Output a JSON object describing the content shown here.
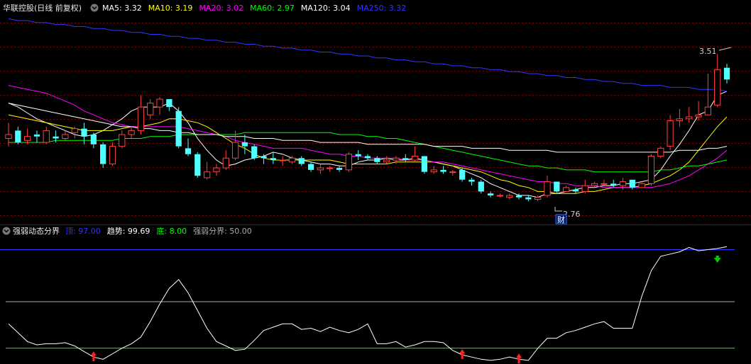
{
  "main_header": {
    "title": "华联控股(日线 前复权)",
    "items": [
      {
        "label": "MA5: 3.32",
        "color": "#ffffff"
      },
      {
        "label": "MA10: 3.19",
        "color": "#ffff00"
      },
      {
        "label": "MA20: 3.02",
        "color": "#ff00ff"
      },
      {
        "label": "MA60: 2.97",
        "color": "#00ff00"
      },
      {
        "label": "MA120: 3.04",
        "color": "#ffffff"
      },
      {
        "label": "MA250: 3.32",
        "color": "#3333ff"
      }
    ]
  },
  "sub_header": {
    "title": "强弱动态分界",
    "items": [
      {
        "label": "顶: 97.00",
        "color": "#3333ff"
      },
      {
        "label": "趋势: 99.69",
        "color": "#ffffff"
      },
      {
        "label": "底: 8.00",
        "color": "#00ff00"
      },
      {
        "label": "强弱分界: 50.00",
        "color": "#aaaaaa"
      }
    ]
  },
  "annotations": {
    "high_label": "3.51",
    "low_label": "2.76",
    "fin_badge": "财"
  },
  "colors": {
    "up": "#ff4040",
    "down": "#50ffff",
    "grid": "#8b0000",
    "ma5": "#ffffff",
    "ma10": "#ffff00",
    "ma20": "#ff00ff",
    "ma60": "#00ff00",
    "ma120": "#ffffff",
    "ma250": "#3333ff",
    "top_line": "#3333ff",
    "mid_line": "#aaaaaa",
    "bottom_line": "#00ff00",
    "buy_arrow": "#ff2020",
    "sell_arrow": "#00cc00"
  },
  "chart_data": [
    {
      "type": "candlestick",
      "title": "华联控股(日线 前复权)",
      "ylim": [
        2.66,
        3.72
      ],
      "candles": [
        [
          3.08,
          3.1,
          3.16,
          3.04
        ],
        [
          3.12,
          3.06,
          3.14,
          3.05
        ],
        [
          3.07,
          3.09,
          3.13,
          3.05
        ],
        [
          3.1,
          3.09,
          3.12,
          3.06
        ],
        [
          3.06,
          3.12,
          3.14,
          3.05
        ],
        [
          3.09,
          3.08,
          3.12,
          3.06
        ],
        [
          3.08,
          3.1,
          3.12,
          3.07
        ],
        [
          3.11,
          3.13,
          3.14,
          3.08
        ],
        [
          3.13,
          3.09,
          3.16,
          3.05
        ],
        [
          3.1,
          3.05,
          3.11,
          3.03
        ],
        [
          3.05,
          2.95,
          3.06,
          2.93
        ],
        [
          2.95,
          3.04,
          3.06,
          2.94
        ],
        [
          3.04,
          3.1,
          3.12,
          3.03
        ],
        [
          3.1,
          3.12,
          3.14,
          3.08
        ],
        [
          3.12,
          3.24,
          3.3,
          3.1
        ],
        [
          3.2,
          3.26,
          3.28,
          3.18
        ],
        [
          3.24,
          3.28,
          3.29,
          3.2
        ],
        [
          3.28,
          3.24,
          3.28,
          3.22
        ],
        [
          3.22,
          3.04,
          3.24,
          3.03
        ],
        [
          3.03,
          3.0,
          3.08,
          2.99
        ],
        [
          3.0,
          2.89,
          3.01,
          2.88
        ],
        [
          2.88,
          2.91,
          2.96,
          2.87
        ],
        [
          2.91,
          2.93,
          2.95,
          2.89
        ],
        [
          2.93,
          2.98,
          3.02,
          2.92
        ],
        [
          2.98,
          3.06,
          3.12,
          2.97
        ],
        [
          3.06,
          3.04,
          3.1,
          3.0
        ],
        [
          3.04,
          2.98,
          3.05,
          2.97
        ],
        [
          2.99,
          2.98,
          3.0,
          2.95
        ],
        [
          2.98,
          2.97,
          3.01,
          2.95
        ],
        [
          2.97,
          2.97,
          2.99,
          2.94
        ],
        [
          2.96,
          2.98,
          2.99,
          2.95
        ],
        [
          2.98,
          2.95,
          2.99,
          2.94
        ],
        [
          2.95,
          2.92,
          2.96,
          2.91
        ],
        [
          2.92,
          2.93,
          2.95,
          2.9
        ],
        [
          2.93,
          2.93,
          2.94,
          2.91
        ],
        [
          2.93,
          2.92,
          2.94,
          2.91
        ],
        [
          2.92,
          3.0,
          3.01,
          2.91
        ],
        [
          3.0,
          2.99,
          3.02,
          2.97
        ],
        [
          2.99,
          2.98,
          3.0,
          2.97
        ],
        [
          2.98,
          2.96,
          2.99,
          2.95
        ],
        [
          2.96,
          2.97,
          2.99,
          2.95
        ],
        [
          2.97,
          2.98,
          2.99,
          2.95
        ],
        [
          2.98,
          2.97,
          3.0,
          2.96
        ],
        [
          2.97,
          2.99,
          3.04,
          2.96
        ],
        [
          2.99,
          2.91,
          2.99,
          2.9
        ],
        [
          2.91,
          2.92,
          2.94,
          2.9
        ],
        [
          2.92,
          2.91,
          2.94,
          2.9
        ],
        [
          2.91,
          2.91,
          2.92,
          2.89
        ],
        [
          2.92,
          2.87,
          2.93,
          2.86
        ],
        [
          2.87,
          2.86,
          2.88,
          2.84
        ],
        [
          2.86,
          2.81,
          2.87,
          2.8
        ],
        [
          2.8,
          2.79,
          2.81,
          2.78
        ],
        [
          2.79,
          2.79,
          2.8,
          2.78
        ],
        [
          2.78,
          2.79,
          2.8,
          2.77
        ],
        [
          2.79,
          2.78,
          2.8,
          2.77
        ],
        [
          2.78,
          2.77,
          2.79,
          2.76
        ],
        [
          2.77,
          2.78,
          2.79,
          2.76
        ],
        [
          2.79,
          2.86,
          2.89,
          2.78
        ],
        [
          2.86,
          2.81,
          2.86,
          2.8
        ],
        [
          2.81,
          2.83,
          2.84,
          2.81
        ],
        [
          2.82,
          2.81,
          2.83,
          2.8
        ],
        [
          2.81,
          2.84,
          2.87,
          2.8
        ],
        [
          2.84,
          2.85,
          2.86,
          2.83
        ],
        [
          2.85,
          2.85,
          2.87,
          2.84
        ],
        [
          2.85,
          2.84,
          2.87,
          2.83
        ],
        [
          2.84,
          2.86,
          2.88,
          2.82
        ],
        [
          2.87,
          2.83,
          2.87,
          2.82
        ],
        [
          2.83,
          2.85,
          2.86,
          2.83
        ],
        [
          2.85,
          2.99,
          3.0,
          2.84
        ],
        [
          2.99,
          3.03,
          3.04,
          2.98
        ],
        [
          3.04,
          3.17,
          3.2,
          3.02
        ],
        [
          3.17,
          3.18,
          3.23,
          3.14
        ],
        [
          3.18,
          3.19,
          3.24,
          3.16
        ],
        [
          3.19,
          3.2,
          3.27,
          3.17
        ],
        [
          3.2,
          3.24,
          3.41,
          3.2
        ],
        [
          3.25,
          3.43,
          3.51,
          3.24
        ],
        [
          3.44,
          3.38,
          3.46,
          3.36
        ]
      ],
      "ma_lines": [
        {
          "key": "ma5",
          "values": [
            3.26,
            3.24,
            3.21,
            3.18,
            3.16,
            3.14,
            3.12,
            3.1,
            3.09,
            3.1,
            3.12,
            3.15,
            3.18,
            3.22,
            3.24,
            3.24,
            3.24,
            3.26,
            3.22,
            3.16,
            3.08,
            3.02,
            2.97,
            2.94,
            2.95,
            2.97,
            2.98,
            2.99,
            3.01,
            3.0,
            2.98,
            2.97,
            2.96,
            2.95,
            2.95,
            2.94,
            2.94,
            2.96,
            2.97,
            2.97,
            2.98,
            2.97,
            2.97,
            2.98,
            2.97,
            2.96,
            2.95,
            2.94,
            2.92,
            2.9,
            2.88,
            2.85,
            2.83,
            2.81,
            2.79,
            2.79,
            2.78,
            2.8,
            2.8,
            2.81,
            2.82,
            2.83,
            2.83,
            2.84,
            2.84,
            2.85,
            2.85,
            2.86,
            2.87,
            2.92,
            2.99,
            3.05,
            3.12,
            3.2,
            3.22,
            3.3,
            3.32
          ]
        },
        {
          "key": "ma10",
          "values": [
            3.2,
            3.19,
            3.18,
            3.17,
            3.16,
            3.15,
            3.14,
            3.13,
            3.12,
            3.12,
            3.12,
            3.12,
            3.13,
            3.14,
            3.14,
            3.15,
            3.16,
            3.18,
            3.18,
            3.17,
            3.16,
            3.14,
            3.11,
            3.08,
            3.05,
            3.03,
            3.0,
            2.98,
            2.97,
            2.97,
            2.97,
            2.97,
            2.97,
            2.97,
            2.97,
            2.96,
            2.95,
            2.95,
            2.95,
            2.95,
            2.95,
            2.96,
            2.96,
            2.96,
            2.96,
            2.96,
            2.95,
            2.94,
            2.93,
            2.92,
            2.91,
            2.89,
            2.87,
            2.86,
            2.84,
            2.83,
            2.81,
            2.81,
            2.8,
            2.8,
            2.8,
            2.81,
            2.81,
            2.82,
            2.83,
            2.83,
            2.83,
            2.84,
            2.85,
            2.87,
            2.89,
            2.92,
            2.96,
            3.02,
            3.08,
            3.14,
            3.19
          ]
        },
        {
          "key": "ma20",
          "values": [
            3.35,
            3.34,
            3.33,
            3.32,
            3.31,
            3.29,
            3.27,
            3.25,
            3.22,
            3.2,
            3.18,
            3.16,
            3.15,
            3.14,
            3.14,
            3.14,
            3.14,
            3.14,
            3.14,
            3.13,
            3.12,
            3.11,
            3.1,
            3.09,
            3.07,
            3.06,
            3.05,
            3.04,
            3.03,
            3.03,
            3.03,
            3.03,
            3.02,
            3.01,
            3.0,
            3.0,
            2.99,
            2.99,
            2.98,
            2.98,
            2.98,
            2.98,
            2.97,
            2.97,
            2.97,
            2.96,
            2.96,
            2.95,
            2.94,
            2.93,
            2.92,
            2.91,
            2.9,
            2.89,
            2.88,
            2.87,
            2.86,
            2.86,
            2.85,
            2.85,
            2.84,
            2.84,
            2.84,
            2.83,
            2.83,
            2.83,
            2.83,
            2.83,
            2.83,
            2.84,
            2.85,
            2.87,
            2.89,
            2.92,
            2.95,
            2.98,
            3.02
          ]
        },
        {
          "key": "ma60",
          "values": [
            3.06,
            3.06,
            3.06,
            3.06,
            3.06,
            3.07,
            3.07,
            3.07,
            3.07,
            3.07,
            3.07,
            3.07,
            3.08,
            3.08,
            3.08,
            3.09,
            3.09,
            3.09,
            3.1,
            3.1,
            3.1,
            3.1,
            3.1,
            3.1,
            3.1,
            3.11,
            3.11,
            3.11,
            3.11,
            3.11,
            3.11,
            3.11,
            3.11,
            3.11,
            3.11,
            3.1,
            3.1,
            3.1,
            3.09,
            3.09,
            3.08,
            3.08,
            3.07,
            3.06,
            3.05,
            3.04,
            3.03,
            3.02,
            3.01,
            3.0,
            2.99,
            2.98,
            2.97,
            2.96,
            2.95,
            2.94,
            2.94,
            2.93,
            2.93,
            2.92,
            2.92,
            2.92,
            2.91,
            2.91,
            2.91,
            2.91,
            2.91,
            2.91,
            2.91,
            2.92,
            2.92,
            2.93,
            2.94,
            2.94,
            2.95,
            2.96,
            2.97
          ]
        },
        {
          "key": "ma120",
          "values": [
            3.26,
            3.25,
            3.24,
            3.23,
            3.22,
            3.21,
            3.2,
            3.19,
            3.18,
            3.17,
            3.16,
            3.15,
            3.14,
            3.14,
            3.13,
            3.13,
            3.12,
            3.12,
            3.11,
            3.11,
            3.1,
            3.1,
            3.1,
            3.09,
            3.09,
            3.09,
            3.08,
            3.08,
            3.08,
            3.07,
            3.07,
            3.07,
            3.07,
            3.06,
            3.06,
            3.06,
            3.06,
            3.06,
            3.05,
            3.05,
            3.05,
            3.05,
            3.05,
            3.05,
            3.05,
            3.04,
            3.04,
            3.04,
            3.04,
            3.03,
            3.03,
            3.03,
            3.03,
            3.02,
            3.02,
            3.02,
            3.02,
            3.02,
            3.01,
            3.01,
            3.01,
            3.01,
            3.01,
            3.01,
            3.01,
            3.01,
            3.01,
            3.01,
            3.01,
            3.01,
            3.01,
            3.02,
            3.02,
            3.02,
            3.03,
            3.03,
            3.04
          ]
        },
        {
          "key": "ma250",
          "values": [
            3.69,
            3.68,
            3.68,
            3.67,
            3.67,
            3.66,
            3.66,
            3.65,
            3.65,
            3.64,
            3.64,
            3.63,
            3.63,
            3.62,
            3.62,
            3.61,
            3.61,
            3.6,
            3.6,
            3.59,
            3.59,
            3.58,
            3.58,
            3.57,
            3.57,
            3.56,
            3.56,
            3.55,
            3.55,
            3.54,
            3.54,
            3.53,
            3.53,
            3.52,
            3.52,
            3.51,
            3.51,
            3.5,
            3.5,
            3.49,
            3.49,
            3.48,
            3.48,
            3.47,
            3.47,
            3.46,
            3.46,
            3.45,
            3.45,
            3.44,
            3.44,
            3.43,
            3.43,
            3.42,
            3.42,
            3.41,
            3.41,
            3.4,
            3.4,
            3.39,
            3.39,
            3.38,
            3.38,
            3.37,
            3.37,
            3.36,
            3.36,
            3.35,
            3.35,
            3.35,
            3.34,
            3.34,
            3.34,
            3.33,
            3.33,
            3.33,
            3.32
          ]
        }
      ]
    },
    {
      "type": "line",
      "title": "强弱动态分界",
      "ylim": [
        -5,
        105
      ],
      "levels": {
        "top": 97.0,
        "mid": 50.0,
        "bottom": 8.0
      },
      "trend": [
        30,
        22,
        14,
        11,
        12,
        12,
        13,
        10,
        5,
        0,
        -2,
        3,
        8,
        12,
        18,
        32,
        48,
        62,
        70,
        58,
        42,
        26,
        14,
        10,
        6,
        7,
        15,
        24,
        27,
        30,
        30,
        25,
        26,
        23,
        27,
        24,
        22,
        25,
        30,
        12,
        12,
        14,
        9,
        11,
        14,
        14,
        13,
        6,
        2,
        0,
        -2,
        -3,
        -2,
        0,
        -2,
        -3,
        8,
        17,
        17,
        22,
        24,
        27,
        30,
        32,
        26,
        26,
        26,
        55,
        78,
        91,
        93,
        95,
        99,
        96,
        97,
        98,
        99.69
      ],
      "buy_signals": [
        9,
        48,
        54
      ],
      "sell_signals": [
        75
      ]
    }
  ]
}
